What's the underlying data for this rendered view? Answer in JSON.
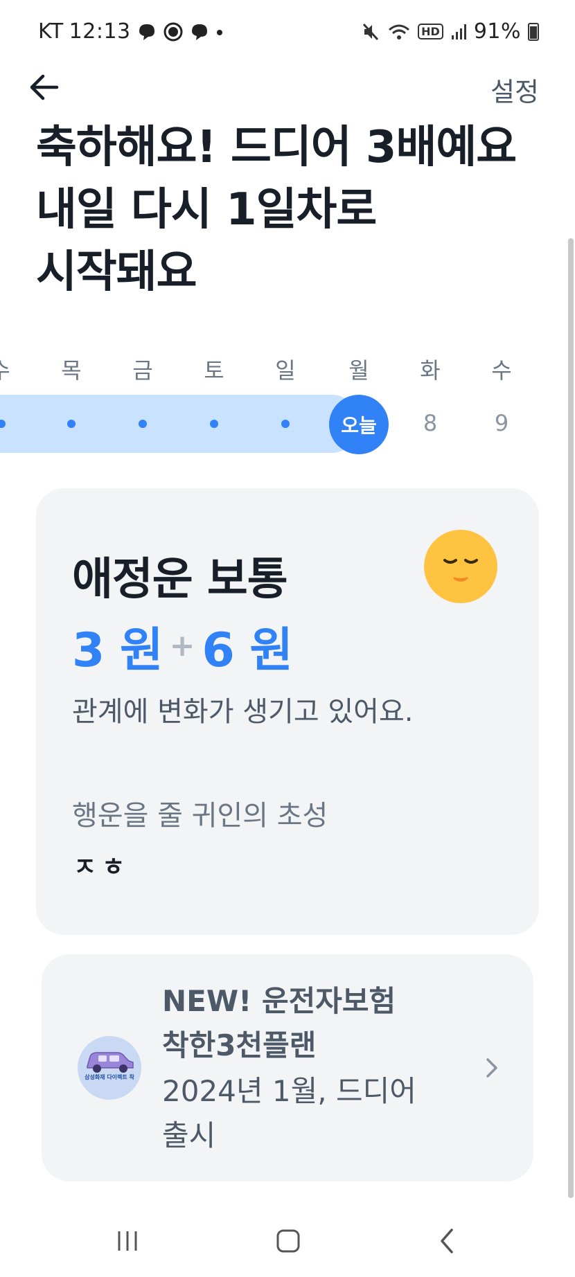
{
  "status_bar": {
    "carrier": "KT",
    "time": "12:13",
    "hd": "HD",
    "battery": "91%"
  },
  "header": {
    "settings_label": "설정"
  },
  "headline": {
    "line1": "축하해요! 드디어 3배예요",
    "line2": "내일 다시 1일차로",
    "line3": "시작돼요"
  },
  "week": {
    "day_labels": [
      "수",
      "목",
      "금",
      "토",
      "일",
      "월",
      "화",
      "수"
    ],
    "today_label": "오늘",
    "future_days": [
      "8",
      "9"
    ]
  },
  "fortune": {
    "title": "애정운 보통",
    "amount_a": "3 원",
    "plus": "+",
    "amount_b": "6 원",
    "description": "관계에 변화가 생기고 있어요.",
    "helper_label": "행운을 줄 귀인의 초성",
    "helper_initials": "ㅈㅎ"
  },
  "ad": {
    "title_line1": "NEW! 운전자보험",
    "title_line2": "착한3천플랜",
    "sub_line1": "2024년 1월, 드디어",
    "sub_line2": "출시",
    "logo_text": "삼성화재 다이렉트 착"
  },
  "colors": {
    "accent": "#3182f6",
    "streak": "#c9e2ff",
    "card": "#f2f4f6",
    "moon": "#ffc342"
  }
}
